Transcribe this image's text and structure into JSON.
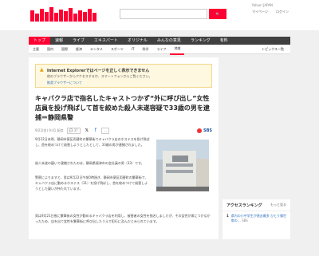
{
  "header": {
    "top_links": "Yahoo! JAPAN",
    "user_links": [
      "マイページ",
      "ログイン"
    ]
  },
  "nav": {
    "items": [
      "トップ",
      "速報",
      "ライブ",
      "エキスパート",
      "オリジナル",
      "みんなの意見",
      "ランキング",
      "有料"
    ]
  },
  "subnav": {
    "items": [
      "主要",
      "国内",
      "国際",
      "経済",
      "エンタメ",
      "スポーツ",
      "IT",
      "科学",
      "ライフ",
      "地域"
    ],
    "right": "トピックス一覧"
  },
  "warning": {
    "title": "Internet Explorerではページを正しく表示できません",
    "text": "他のブラウザーからアクセスするか、スマートフォンからご覧ください。",
    "link": "推奨ブラウザーについて"
  },
  "article": {
    "headline": "キャバクラ店で指名したキャストつかず“外に呼び出し”女性店員を投げ飛ばして首を絞めた殺人未遂容疑で33歳の男を逮捕＝静岡県警",
    "date": "9/22(金) 9:41 配信",
    "comments": "37",
    "source": "SBS",
    "paragraphs": [
      "9月22日未明、静岡市葵区両替町の繁華街でキャバクラ店のホステスを投げ飛ばし、首を絞めつけて殺害しようとしたとして、33歳の男が逮捕されました。",
      "殺人未遂の疑いで逮捕されたのは、静岡県焼津市の会社員の男（33）です。",
      "警察によりますと、男は9月22日午前0時過ぎ、静岡市葵区両替町の繁華街で、キャバクラ店に勤めるホステス（31）を投げ飛ばし、首を絞めつけて殺害しようとした疑いが持たれています。",
      "男は9月21日夜に繁華街の女性が勤めるキャバクラ店を利用し、被害者の女性を指名しましたが、その女性が席につかなかったため、店を出て女性を繁華街に呼び出したうえで犯行に及んだとみられています。"
    ]
  },
  "sidebar": {
    "access_ranking_title": "アクセスランキング",
    "more": "もっと見る",
    "rank1": {
      "num": "1",
      "text": "県内の小中学生が過去最多 ひとり親世帯の…",
      "src": "SBS"
    }
  }
}
